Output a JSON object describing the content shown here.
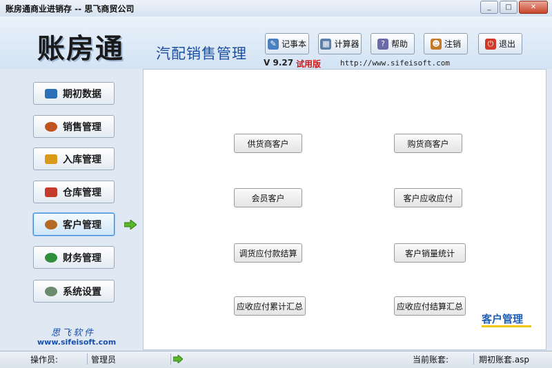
{
  "window": {
    "title": "账房通商业进销存 -- 思飞商贸公司",
    "minimize": "_",
    "maximize": "□",
    "close": "✕"
  },
  "header": {
    "logo": "账房通",
    "subtitle": "汽配销售管理",
    "version": "V 9.27",
    "trial": "试用版",
    "url": "http://www.sifeisoft.com"
  },
  "toolbar": {
    "notepad": "记事本",
    "calculator": "计算器",
    "help": "帮助",
    "logout": "注销",
    "exit": "退出"
  },
  "sidebar": {
    "items": [
      {
        "label": "期初数据",
        "icon": "book-icon",
        "color": "#2a6fb8"
      },
      {
        "label": "销售管理",
        "icon": "sales-person-icon",
        "color": "#c0521e"
      },
      {
        "label": "入库管理",
        "icon": "box-icon",
        "color": "#d99a17"
      },
      {
        "label": "仓库管理",
        "icon": "warehouse-icon",
        "color": "#c43b2c"
      },
      {
        "label": "客户管理",
        "icon": "customers-icon",
        "color": "#b46a22"
      },
      {
        "label": "财务管理",
        "icon": "money-icon",
        "color": "#2f8f3a"
      },
      {
        "label": "系统设置",
        "icon": "gears-icon",
        "color": "#6d8a6d"
      }
    ],
    "active_index": 4,
    "company": "思飞软件",
    "site": "www.sifeisoft.com"
  },
  "main": {
    "buttons": [
      "供货商客户",
      "购货商客户",
      "会员客户",
      "客户应收应付",
      "调货应付款结算",
      "客户销量统计",
      "应收应付累计汇总",
      "应收应付结算汇总"
    ],
    "section_label": "客户管理"
  },
  "status": {
    "operator_label": "操作员:",
    "operator_value": "管理员",
    "account_label": "当前账套:",
    "account_value": "期初账套.asp"
  },
  "colors": {
    "accent": "#1f5fb5",
    "trial": "#d01818"
  }
}
